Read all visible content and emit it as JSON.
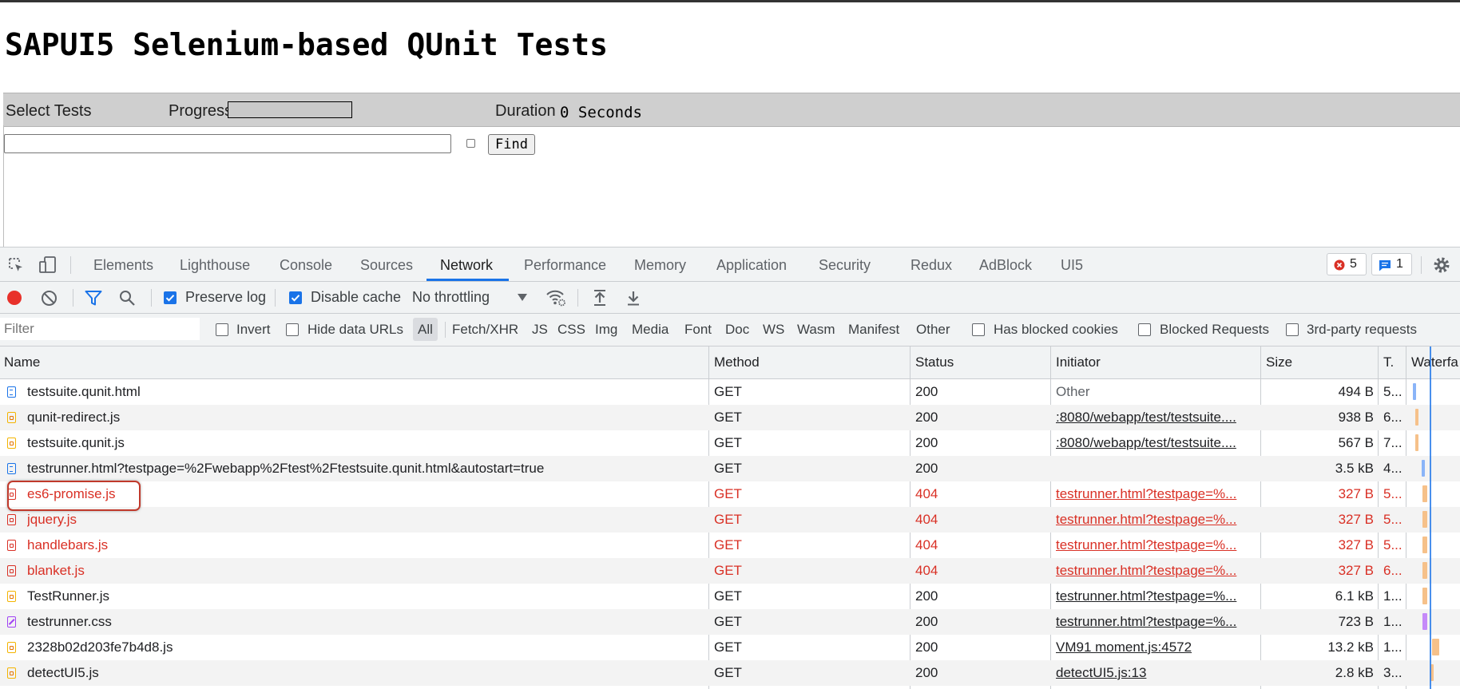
{
  "page": {
    "title": "SAPUI5 Selenium-based QUnit Tests",
    "select_tests_label": "Select Tests",
    "progress_label": "Progress",
    "duration_label": "Duration",
    "duration_value": "0 Seconds",
    "find_button": "Find"
  },
  "devtools": {
    "tabs": [
      "Elements",
      "Lighthouse",
      "Console",
      "Sources",
      "Network",
      "Performance",
      "Memory",
      "Application",
      "Security",
      "Redux",
      "AdBlock",
      "UI5"
    ],
    "active_tab": "Network",
    "error_count": "5",
    "message_count": "1",
    "toolbar": {
      "preserve_log": "Preserve log",
      "preserve_log_checked": true,
      "disable_cache": "Disable cache",
      "disable_cache_checked": true,
      "throttling": "No throttling"
    },
    "filter": {
      "placeholder": "Filter",
      "invert": "Invert",
      "hide_data_urls": "Hide data URLs",
      "types": [
        "All",
        "Fetch/XHR",
        "JS",
        "CSS",
        "Img",
        "Media",
        "Font",
        "Doc",
        "WS",
        "Wasm",
        "Manifest",
        "Other"
      ],
      "has_blocked_cookies": "Has blocked cookies",
      "blocked_requests": "Blocked Requests",
      "third_party": "3rd-party requests"
    },
    "columns": {
      "name": "Name",
      "method": "Method",
      "status": "Status",
      "initiator": "Initiator",
      "size": "Size",
      "time": "T.",
      "waterfall": "Waterfa"
    },
    "colors": {
      "accent": "#1a73e8",
      "error": "#d93025",
      "record": "#e8312a"
    },
    "requests": [
      {
        "name": "testsuite.qunit.html",
        "type": "doc",
        "method": "GET",
        "status": "200",
        "initiator": "Other",
        "size": "494 B",
        "time": "5...",
        "error": false
      },
      {
        "name": "qunit-redirect.js",
        "type": "script",
        "method": "GET",
        "status": "200",
        "initiator": ":8080/webapp/test/testsuite....",
        "size": "938 B",
        "time": "6...",
        "error": false
      },
      {
        "name": "testsuite.qunit.js",
        "type": "script",
        "method": "GET",
        "status": "200",
        "initiator": ":8080/webapp/test/testsuite....",
        "size": "567 B",
        "time": "7...",
        "error": false
      },
      {
        "name": "testrunner.html?testpage=%2Fwebapp%2Ftest%2Ftestsuite.qunit.html&autostart=true",
        "type": "doc",
        "method": "GET",
        "status": "200",
        "initiator": "",
        "size": "3.5 kB",
        "time": "4...",
        "error": false
      },
      {
        "name": "es6-promise.js",
        "type": "err",
        "method": "GET",
        "status": "404",
        "initiator": "testrunner.html?testpage=%...",
        "size": "327 B",
        "time": "5...",
        "error": true
      },
      {
        "name": "jquery.js",
        "type": "err",
        "method": "GET",
        "status": "404",
        "initiator": "testrunner.html?testpage=%...",
        "size": "327 B",
        "time": "5...",
        "error": true
      },
      {
        "name": "handlebars.js",
        "type": "err",
        "method": "GET",
        "status": "404",
        "initiator": "testrunner.html?testpage=%...",
        "size": "327 B",
        "time": "5...",
        "error": true
      },
      {
        "name": "blanket.js",
        "type": "err",
        "method": "GET",
        "status": "404",
        "initiator": "testrunner.html?testpage=%...",
        "size": "327 B",
        "time": "6...",
        "error": true
      },
      {
        "name": "TestRunner.js",
        "type": "script",
        "method": "GET",
        "status": "200",
        "initiator": "testrunner.html?testpage=%...",
        "size": "6.1 kB",
        "time": "1...",
        "error": false
      },
      {
        "name": "testrunner.css",
        "type": "style",
        "method": "GET",
        "status": "200",
        "initiator": "testrunner.html?testpage=%...",
        "size": "723 B",
        "time": "1...",
        "error": false
      },
      {
        "name": "2328b02d203fe7b4d8.js",
        "type": "script",
        "method": "GET",
        "status": "200",
        "initiator": "VM91 moment.js:4572",
        "size": "13.2 kB",
        "time": "1...",
        "error": false
      },
      {
        "name": "detectUI5.js",
        "type": "script",
        "method": "GET",
        "status": "200",
        "initiator": "detectUI5.js:13",
        "size": "2.8 kB",
        "time": "3...",
        "error": false
      }
    ]
  }
}
